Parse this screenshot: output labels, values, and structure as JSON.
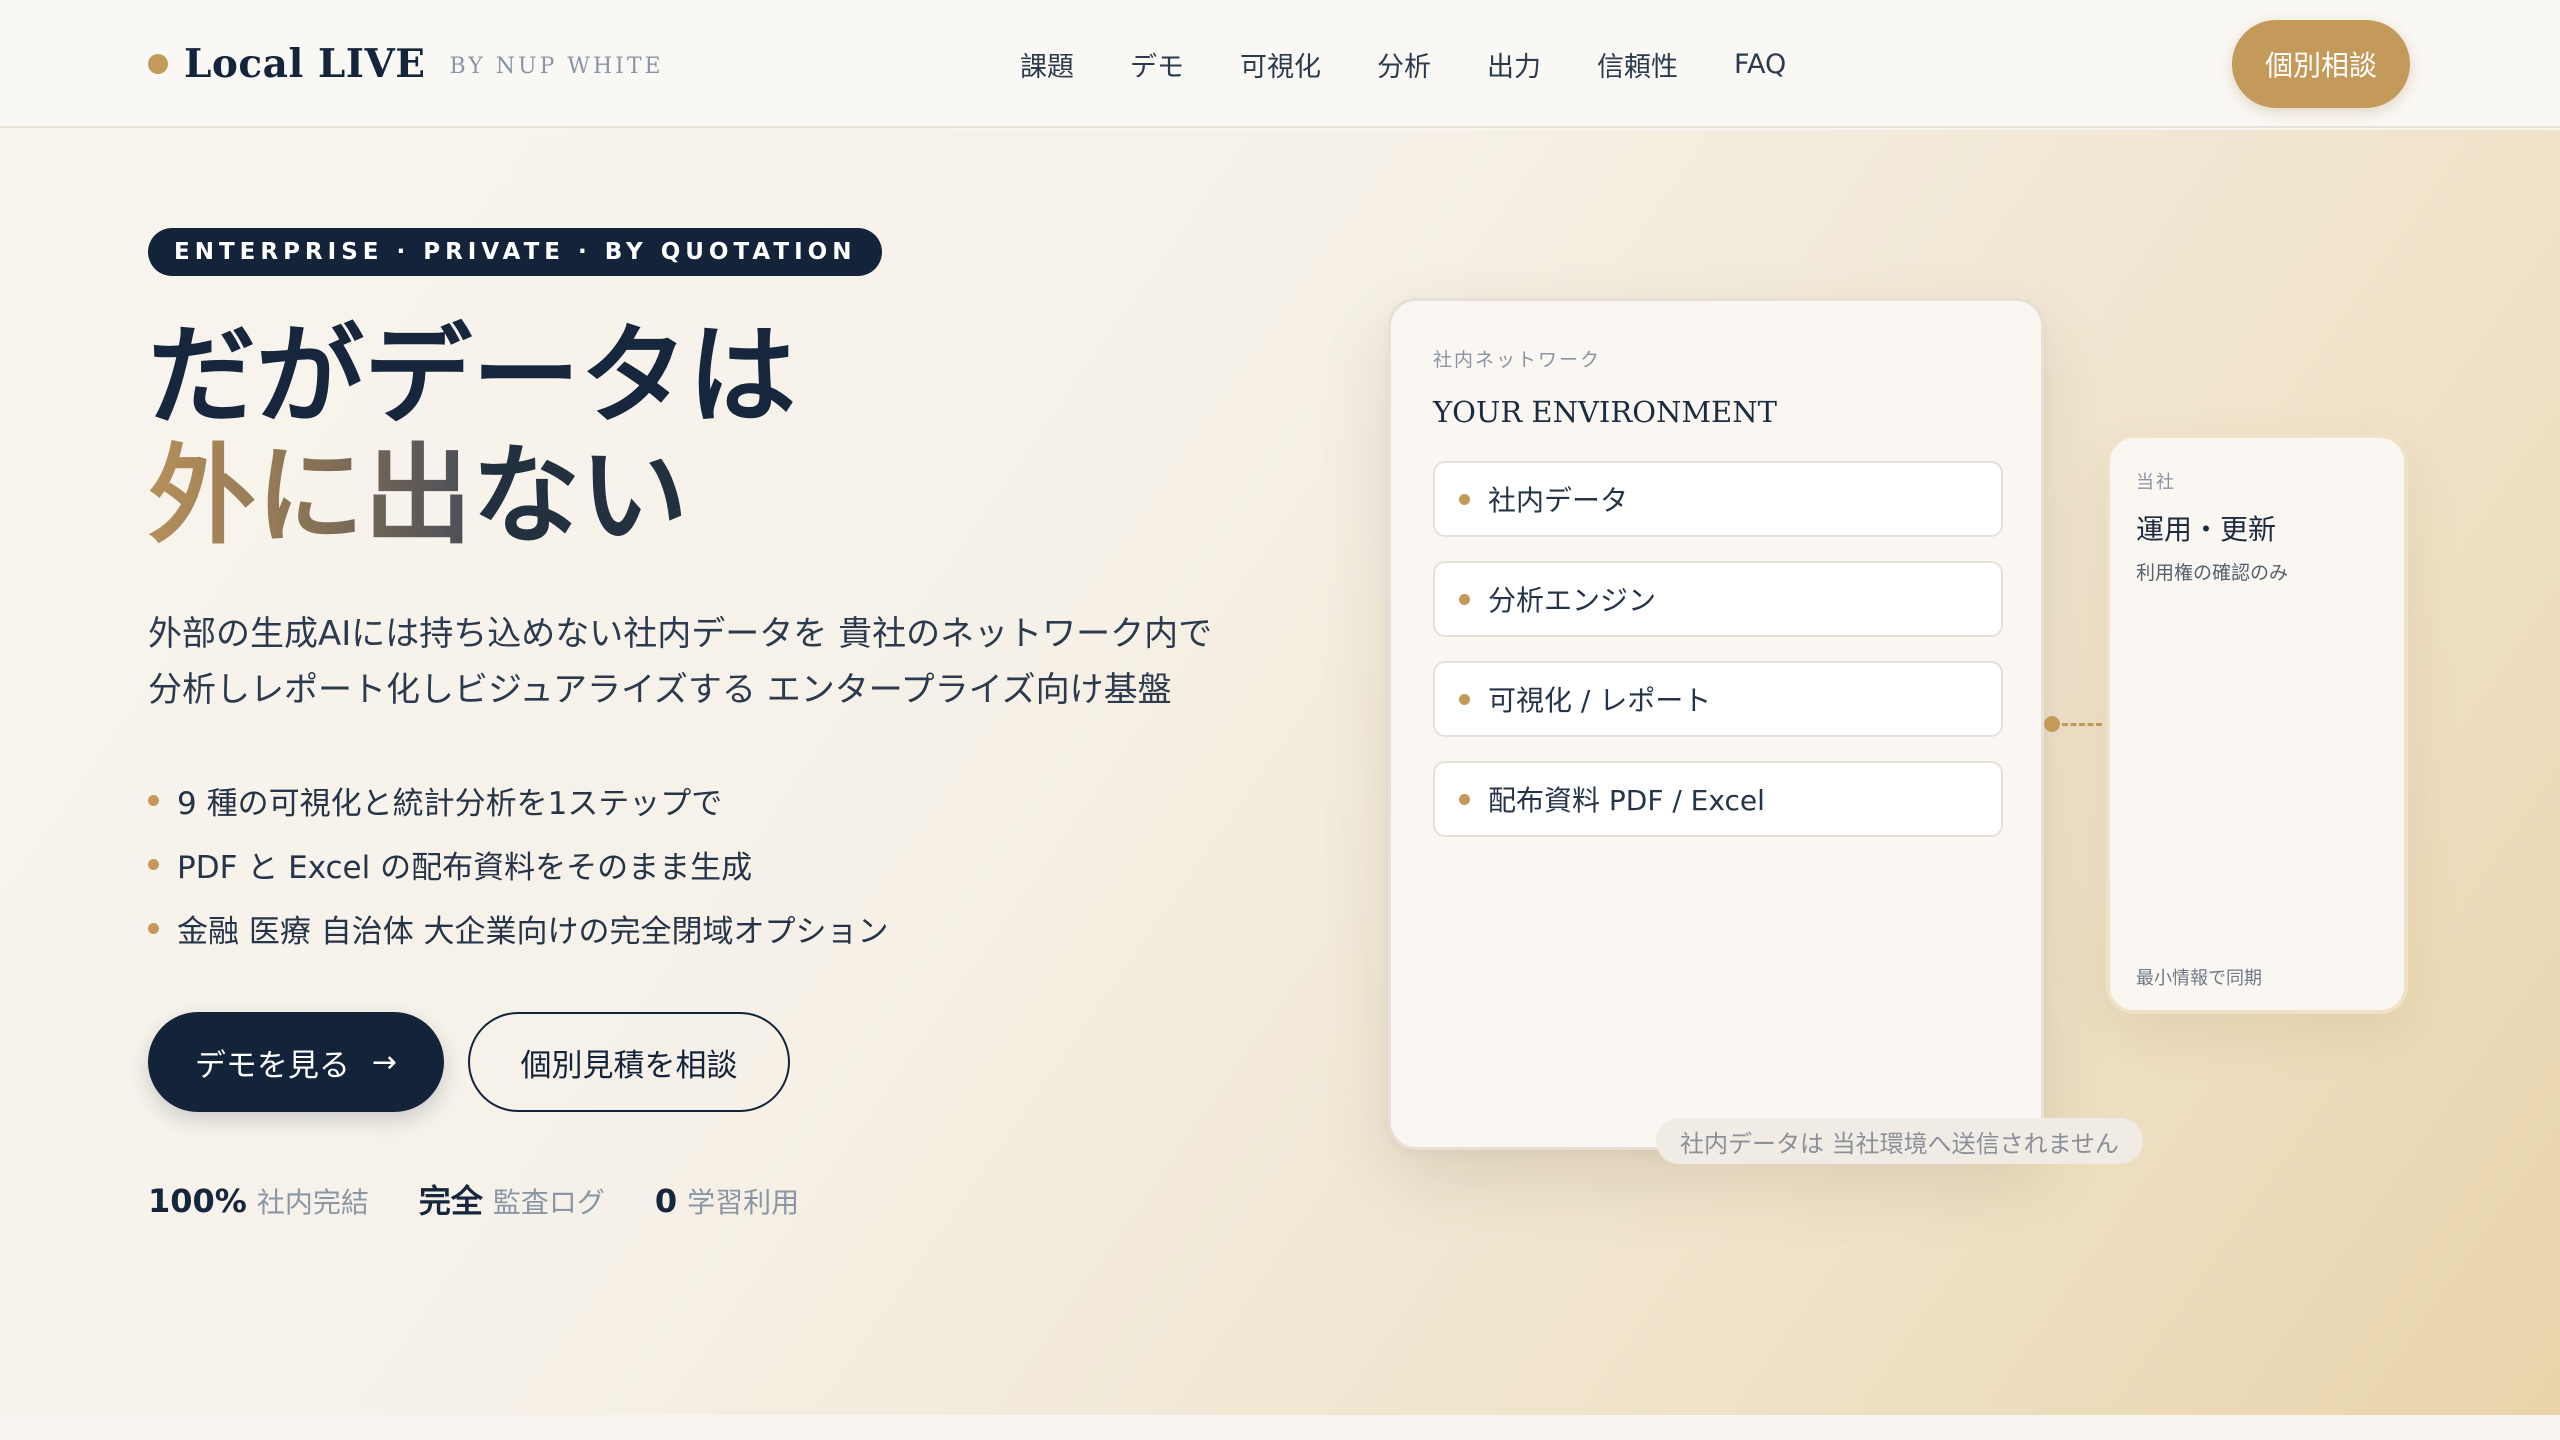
{
  "header": {
    "brand": "Local LIVE",
    "brand_sub": "BY NUP WHITE",
    "nav": [
      "課題",
      "デモ",
      "可視化",
      "分析",
      "出力",
      "信頼性",
      "FAQ"
    ],
    "cta_label": "個別相談"
  },
  "hero": {
    "badge": "ENTERPRISE · PRIVATE · BY QUOTATION",
    "headline_line1": "だがデータは",
    "headline_line2_accent": "外に出",
    "headline_line2_rest": "ない",
    "lead_line1": "外部の生成AIには持ち込めない社内データを 貴社のネットワーク内で",
    "lead_line2": "分析しレポート化しビジュアライズする エンタープライズ向け基盤",
    "bullets": [
      "9 種の可視化と統計分析を1ステップで",
      "PDF と Excel の配布資料をそのまま生成",
      "金融 医療 自治体 大企業向けの完全閉域オプション"
    ],
    "primary_button": "デモを見る",
    "primary_arrow": "→",
    "secondary_button": "個別見積を相談",
    "stats": [
      {
        "value": "100%",
        "label": "社内完結"
      },
      {
        "value": "完全",
        "label": "監査ログ"
      },
      {
        "value": "0",
        "label": "学習利用"
      }
    ]
  },
  "diagram": {
    "env_kicker": "社内ネットワーク",
    "env_title": "YOUR ENVIRONMENT",
    "env_items": [
      "社内データ",
      "分析エンジン",
      "可視化 / レポート",
      "配布資料 PDF / Excel"
    ],
    "company_kicker": "当社",
    "company_title": "運用・更新",
    "company_desc": "利用権の確認のみ",
    "company_foot": "最小情報で同期",
    "note": "社内データは 当社環境へ送信されません"
  },
  "colors": {
    "navy": "#13233a",
    "gold": "#c49a5a"
  }
}
